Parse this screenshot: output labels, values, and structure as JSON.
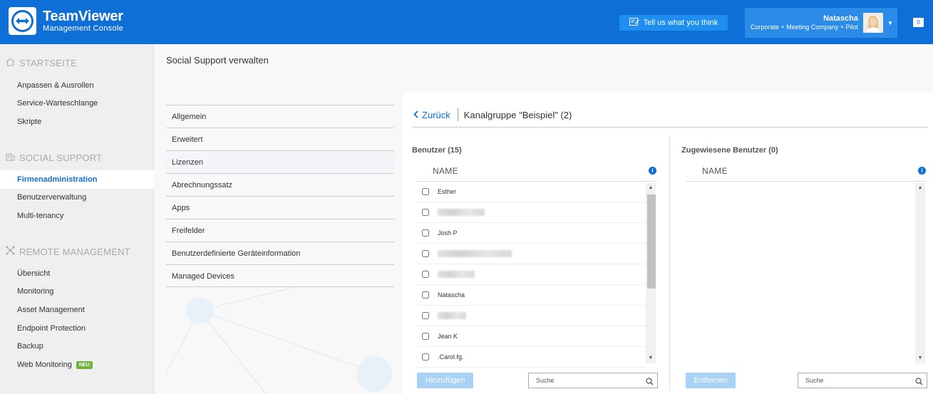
{
  "header": {
    "brand_name": "TeamViewer",
    "brand_sub": "Management Console",
    "feedback_label": "Tell us what you think",
    "user_name": "Natascha",
    "user_plan": "Corporate + Meeting Company + Pilot",
    "notification_count": "0"
  },
  "sidebar": {
    "sections": [
      {
        "title": "STARTSEITE",
        "icon": "home-icon",
        "items": [
          "Anpassen & Ausrollen",
          "Service-Warteschlange",
          "Skripte"
        ]
      },
      {
        "title": "SOCIAL SUPPORT",
        "icon": "building-icon",
        "items": [
          "Firmenadministration",
          "Benutzerverwaltung",
          "Multi-tenancy"
        ]
      },
      {
        "title": "REMOTE MANAGEMENT",
        "icon": "network-icon",
        "items": [
          "Übersicht",
          "Monitoring",
          "Asset Management",
          "Endpoint Protection",
          "Backup",
          "Web Monitoring"
        ]
      }
    ],
    "active_item": "Firmenadministration",
    "new_badge": "NEU"
  },
  "page": {
    "title": "Social Support verwalten",
    "tabs": [
      "Allgemein",
      "Erweitert",
      "Lizenzen",
      "Abrechnungssatz",
      "Apps",
      "Freifelder",
      "Benutzerdefinierte Geräteinformation",
      "Managed Devices"
    ],
    "selected_tab": "Lizenzen"
  },
  "detail": {
    "back_label": "Zurück",
    "group_title": "Kanalgruppe \"Beispiel\" (2)",
    "users": {
      "title": "Benutzer (15)",
      "column": "NAME",
      "rows": [
        "Esther",
        "",
        "Josh P",
        "",
        "",
        "Natascha",
        "",
        "Jean K",
        ".Carol.fg."
      ],
      "add_label": "Hinzufügen",
      "search_placeholder": "Suche"
    },
    "assigned": {
      "title": "Zugewiesene Benutzer (0)",
      "column": "NAME",
      "remove_label": "Entfernen",
      "search_placeholder": "Suche"
    }
  },
  "colors": {
    "header_bg": "#0e6fd6",
    "accent": "#0e6fd6",
    "new_badge": "#6cb33f",
    "disabled_button": "#a8d1f5"
  }
}
